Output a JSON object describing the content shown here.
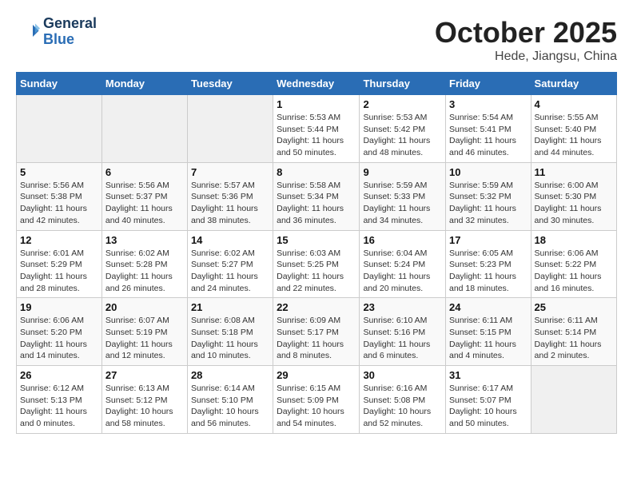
{
  "header": {
    "logo_line1": "General",
    "logo_line2": "Blue",
    "month": "October 2025",
    "location": "Hede, Jiangsu, China"
  },
  "weekdays": [
    "Sunday",
    "Monday",
    "Tuesday",
    "Wednesday",
    "Thursday",
    "Friday",
    "Saturday"
  ],
  "weeks": [
    [
      {
        "day": "",
        "empty": true
      },
      {
        "day": "",
        "empty": true
      },
      {
        "day": "",
        "empty": true
      },
      {
        "day": "1",
        "sunrise": "Sunrise: 5:53 AM",
        "sunset": "Sunset: 5:44 PM",
        "daylight": "Daylight: 11 hours and 50 minutes."
      },
      {
        "day": "2",
        "sunrise": "Sunrise: 5:53 AM",
        "sunset": "Sunset: 5:42 PM",
        "daylight": "Daylight: 11 hours and 48 minutes."
      },
      {
        "day": "3",
        "sunrise": "Sunrise: 5:54 AM",
        "sunset": "Sunset: 5:41 PM",
        "daylight": "Daylight: 11 hours and 46 minutes."
      },
      {
        "day": "4",
        "sunrise": "Sunrise: 5:55 AM",
        "sunset": "Sunset: 5:40 PM",
        "daylight": "Daylight: 11 hours and 44 minutes."
      }
    ],
    [
      {
        "day": "5",
        "sunrise": "Sunrise: 5:56 AM",
        "sunset": "Sunset: 5:38 PM",
        "daylight": "Daylight: 11 hours and 42 minutes."
      },
      {
        "day": "6",
        "sunrise": "Sunrise: 5:56 AM",
        "sunset": "Sunset: 5:37 PM",
        "daylight": "Daylight: 11 hours and 40 minutes."
      },
      {
        "day": "7",
        "sunrise": "Sunrise: 5:57 AM",
        "sunset": "Sunset: 5:36 PM",
        "daylight": "Daylight: 11 hours and 38 minutes."
      },
      {
        "day": "8",
        "sunrise": "Sunrise: 5:58 AM",
        "sunset": "Sunset: 5:34 PM",
        "daylight": "Daylight: 11 hours and 36 minutes."
      },
      {
        "day": "9",
        "sunrise": "Sunrise: 5:59 AM",
        "sunset": "Sunset: 5:33 PM",
        "daylight": "Daylight: 11 hours and 34 minutes."
      },
      {
        "day": "10",
        "sunrise": "Sunrise: 5:59 AM",
        "sunset": "Sunset: 5:32 PM",
        "daylight": "Daylight: 11 hours and 32 minutes."
      },
      {
        "day": "11",
        "sunrise": "Sunrise: 6:00 AM",
        "sunset": "Sunset: 5:30 PM",
        "daylight": "Daylight: 11 hours and 30 minutes."
      }
    ],
    [
      {
        "day": "12",
        "sunrise": "Sunrise: 6:01 AM",
        "sunset": "Sunset: 5:29 PM",
        "daylight": "Daylight: 11 hours and 28 minutes."
      },
      {
        "day": "13",
        "sunrise": "Sunrise: 6:02 AM",
        "sunset": "Sunset: 5:28 PM",
        "daylight": "Daylight: 11 hours and 26 minutes."
      },
      {
        "day": "14",
        "sunrise": "Sunrise: 6:02 AM",
        "sunset": "Sunset: 5:27 PM",
        "daylight": "Daylight: 11 hours and 24 minutes."
      },
      {
        "day": "15",
        "sunrise": "Sunrise: 6:03 AM",
        "sunset": "Sunset: 5:25 PM",
        "daylight": "Daylight: 11 hours and 22 minutes."
      },
      {
        "day": "16",
        "sunrise": "Sunrise: 6:04 AM",
        "sunset": "Sunset: 5:24 PM",
        "daylight": "Daylight: 11 hours and 20 minutes."
      },
      {
        "day": "17",
        "sunrise": "Sunrise: 6:05 AM",
        "sunset": "Sunset: 5:23 PM",
        "daylight": "Daylight: 11 hours and 18 minutes."
      },
      {
        "day": "18",
        "sunrise": "Sunrise: 6:06 AM",
        "sunset": "Sunset: 5:22 PM",
        "daylight": "Daylight: 11 hours and 16 minutes."
      }
    ],
    [
      {
        "day": "19",
        "sunrise": "Sunrise: 6:06 AM",
        "sunset": "Sunset: 5:20 PM",
        "daylight": "Daylight: 11 hours and 14 minutes."
      },
      {
        "day": "20",
        "sunrise": "Sunrise: 6:07 AM",
        "sunset": "Sunset: 5:19 PM",
        "daylight": "Daylight: 11 hours and 12 minutes."
      },
      {
        "day": "21",
        "sunrise": "Sunrise: 6:08 AM",
        "sunset": "Sunset: 5:18 PM",
        "daylight": "Daylight: 11 hours and 10 minutes."
      },
      {
        "day": "22",
        "sunrise": "Sunrise: 6:09 AM",
        "sunset": "Sunset: 5:17 PM",
        "daylight": "Daylight: 11 hours and 8 minutes."
      },
      {
        "day": "23",
        "sunrise": "Sunrise: 6:10 AM",
        "sunset": "Sunset: 5:16 PM",
        "daylight": "Daylight: 11 hours and 6 minutes."
      },
      {
        "day": "24",
        "sunrise": "Sunrise: 6:11 AM",
        "sunset": "Sunset: 5:15 PM",
        "daylight": "Daylight: 11 hours and 4 minutes."
      },
      {
        "day": "25",
        "sunrise": "Sunrise: 6:11 AM",
        "sunset": "Sunset: 5:14 PM",
        "daylight": "Daylight: 11 hours and 2 minutes."
      }
    ],
    [
      {
        "day": "26",
        "sunrise": "Sunrise: 6:12 AM",
        "sunset": "Sunset: 5:13 PM",
        "daylight": "Daylight: 11 hours and 0 minutes."
      },
      {
        "day": "27",
        "sunrise": "Sunrise: 6:13 AM",
        "sunset": "Sunset: 5:12 PM",
        "daylight": "Daylight: 10 hours and 58 minutes."
      },
      {
        "day": "28",
        "sunrise": "Sunrise: 6:14 AM",
        "sunset": "Sunset: 5:10 PM",
        "daylight": "Daylight: 10 hours and 56 minutes."
      },
      {
        "day": "29",
        "sunrise": "Sunrise: 6:15 AM",
        "sunset": "Sunset: 5:09 PM",
        "daylight": "Daylight: 10 hours and 54 minutes."
      },
      {
        "day": "30",
        "sunrise": "Sunrise: 6:16 AM",
        "sunset": "Sunset: 5:08 PM",
        "daylight": "Daylight: 10 hours and 52 minutes."
      },
      {
        "day": "31",
        "sunrise": "Sunrise: 6:17 AM",
        "sunset": "Sunset: 5:07 PM",
        "daylight": "Daylight: 10 hours and 50 minutes."
      },
      {
        "day": "",
        "empty": true
      }
    ]
  ]
}
